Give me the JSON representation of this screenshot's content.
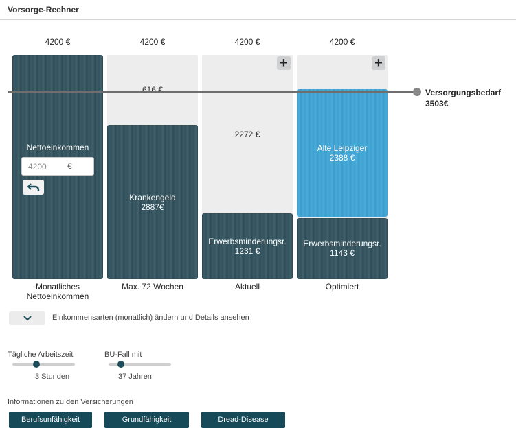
{
  "header": {
    "title": "Vorsorge-Rechner"
  },
  "columns": [
    {
      "total": "4200 €",
      "caption_line1": "Monatliches",
      "caption_line2": "Nettoeinkommen"
    },
    {
      "total": "4200 €",
      "gap": "616 €",
      "segment_name": "Krankengeld",
      "segment_value": "2887€",
      "caption_line1": "Max. 72 Wochen"
    },
    {
      "total": "4200 €",
      "gap": "2272 €",
      "segment_name": "Erwerbsminderungsr.",
      "segment_value": "1231 €",
      "caption_line1": "Aktuell",
      "add_icon": "plus-icon"
    },
    {
      "total": "4200 €",
      "top_name": "Alte Leipziger",
      "top_value": "2388 €",
      "segment_name": "Erwerbsminderungsr.",
      "segment_value": "1143 €",
      "caption_line1": "Optimiert",
      "add_icon": "plus-icon"
    }
  ],
  "bar_levels": {
    "scale_max": 4200,
    "col2_krankengeld": 2887,
    "col3_erwerbsminderung": 1231,
    "col4_erwerbsminderung": 1143,
    "col4_alte_leipziger": 2388,
    "need": 3503
  },
  "need": {
    "label": "Versorgungsbedarf",
    "value": "3503€"
  },
  "netto": {
    "label": "Nettoeinkommen",
    "input_value": "4200",
    "currency": "€",
    "undo_icon": "undo-icon"
  },
  "details_toggle": {
    "icon": "chevron-down-icon",
    "text": "Einkommensarten (monatlich) ändern und Details ansehen"
  },
  "sliders": [
    {
      "label": "Tägliche Arbeitszeit",
      "value": "3 Stunden",
      "level": 0.38
    },
    {
      "label": "BU-Fall mit",
      "value": "37 Jahren",
      "level": 0.2
    }
  ],
  "info": {
    "label": "Informationen zu den Versicherungen",
    "buttons": [
      "Berufsunfähigkeit",
      "Grundfähigkeit",
      "Dread-Disease"
    ]
  },
  "colors": {
    "dark": "#2d4a55",
    "blue": "#46a6d4",
    "button": "#164a58"
  }
}
